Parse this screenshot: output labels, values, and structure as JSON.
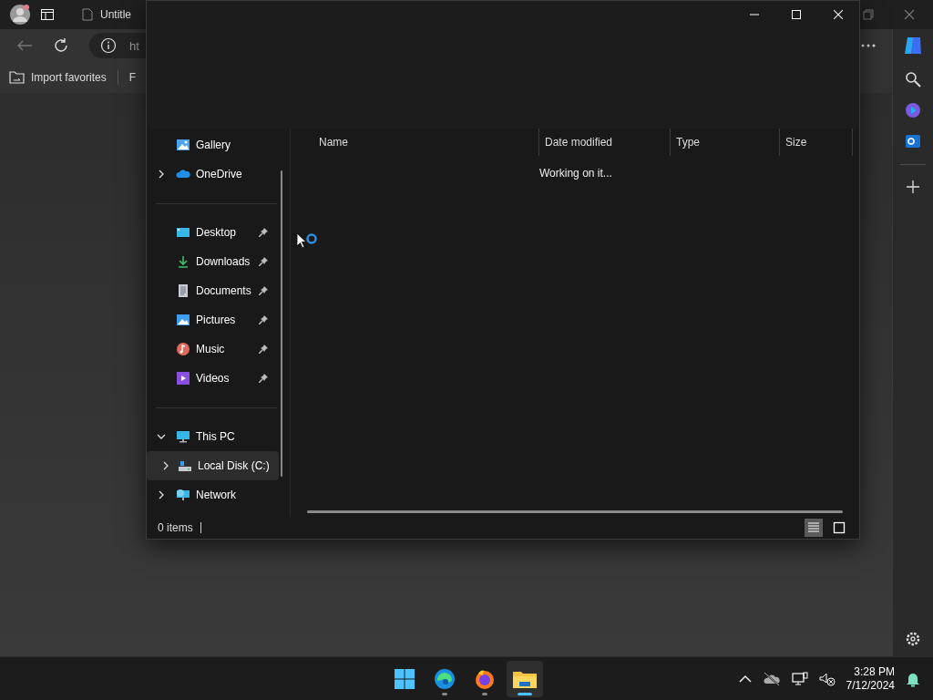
{
  "browser": {
    "tab_title": "Untitle",
    "address": "ht",
    "favorites": [
      {
        "kind": "import",
        "label": "Import favorites"
      },
      {
        "kind": "plain",
        "label": "F"
      }
    ]
  },
  "explorer": {
    "nav_groups": [
      [
        {
          "kind": "gallery",
          "label": "Gallery",
          "pinned": false,
          "selected": false
        },
        {
          "kind": "cloud",
          "label": "OneDrive",
          "expanded": false,
          "pinned": false,
          "selected": false
        }
      ],
      [
        {
          "kind": "desktop",
          "label": "Desktop",
          "pinned": true,
          "selected": false
        },
        {
          "kind": "downloads",
          "label": "Downloads",
          "pinned": true,
          "selected": false
        },
        {
          "kind": "documents",
          "label": "Documents",
          "pinned": true,
          "selected": false
        },
        {
          "kind": "pictures",
          "label": "Pictures",
          "pinned": true,
          "selected": false
        },
        {
          "kind": "music",
          "label": "Music",
          "pinned": true,
          "selected": false
        },
        {
          "kind": "videos",
          "label": "Videos",
          "pinned": true,
          "selected": false
        }
      ],
      [
        {
          "kind": "pc",
          "label": "This PC",
          "expanded": true,
          "pinned": false,
          "selected": false,
          "children": [
            {
              "kind": "disk",
              "label": "Local Disk (C:)",
              "expanded": false,
              "pinned": false,
              "selected": true
            }
          ]
        },
        {
          "kind": "network",
          "label": "Network",
          "expanded": false,
          "pinned": false,
          "selected": false
        }
      ]
    ],
    "columns": [
      "Name",
      "Date modified",
      "Type",
      "Size"
    ],
    "message": "Working on it...",
    "status": "0 items",
    "views": [
      {
        "kind": "details",
        "selected": true
      },
      {
        "kind": "tiles",
        "selected": false
      }
    ]
  },
  "taskbar": {
    "apps": [
      {
        "kind": "start",
        "running": false,
        "active": false
      },
      {
        "kind": "edge",
        "running": true,
        "active": false
      },
      {
        "kind": "firefox",
        "running": true,
        "active": false
      },
      {
        "kind": "explorer",
        "running": true,
        "active": true
      }
    ],
    "time": "3:28 PM",
    "date": "7/12/2024"
  }
}
